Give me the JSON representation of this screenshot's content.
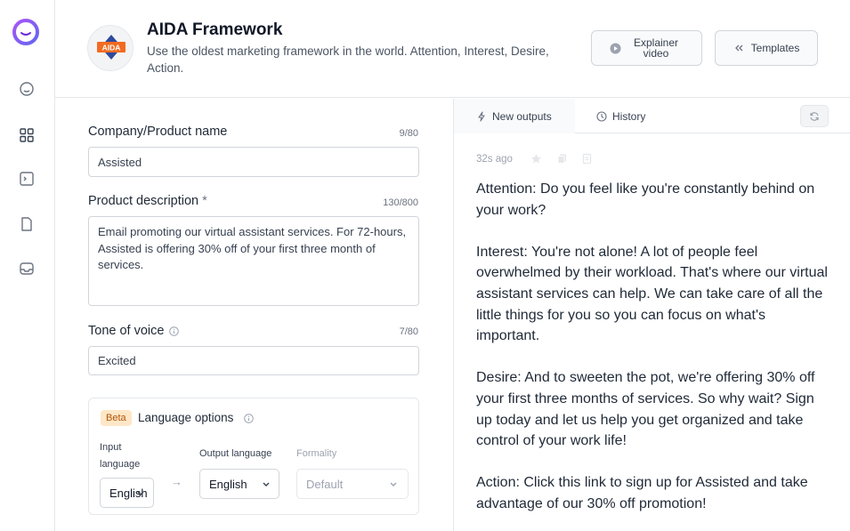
{
  "header": {
    "title": "AIDA Framework",
    "description": "Use the oldest marketing framework in the world. Attention, Interest, Desire, Action.",
    "template_icon_text": "AIDA",
    "explainer_label": "Explainer video",
    "templates_label": "Templates"
  },
  "form": {
    "company": {
      "label": "Company/Product name",
      "count": "9/80",
      "value": "Assisted"
    },
    "description": {
      "label": "Product description",
      "required": "*",
      "count": "130/800",
      "value": "Email promoting our virtual assistant services. For 72-hours, Assisted is offering 30% off of your first three month of services."
    },
    "tone": {
      "label": "Tone of voice",
      "count": "7/80",
      "value": "Excited"
    },
    "language": {
      "badge": "Beta",
      "title": "Language options",
      "input_label": "Input language",
      "input_value": "English",
      "arrow": "→",
      "output_label": "Output language",
      "output_value": "English",
      "formality_label": "Formality",
      "formality_value": "Default"
    }
  },
  "outputs": {
    "tab_new": "New outputs",
    "tab_history": "History",
    "time": "32s ago",
    "text": "Attention: Do you feel like you're constantly behind on your work?\n\nInterest: You're not alone! A lot of people feel overwhelmed by their workload. That's where our virtual assistant services can help. We can take care of all the little things for you so you can focus on what's important.\n\nDesire: And to sweeten the pot, we're offering 30% off your first three months of services. So why wait? Sign up today and let us help you get organized and take control of your work life!\n\nAction: Click this link to sign up for Assisted and take advantage of our 30% off promotion!"
  },
  "colors": {
    "accent": "#7c3aed",
    "brand_orange": "#f26b21",
    "brand_blue": "#2f4a9e"
  }
}
